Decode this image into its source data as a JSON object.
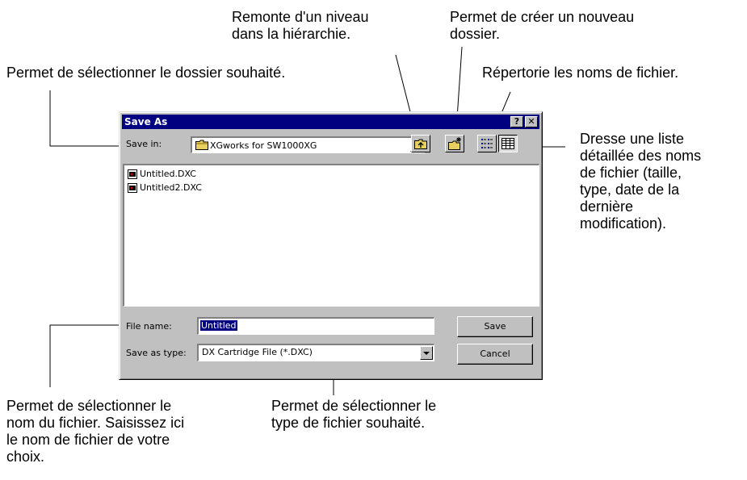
{
  "annotations": {
    "up_level": [
      "Remonte d'un niveau",
      "dans la hiérarchie."
    ],
    "new_folder": [
      "Permet de créer un nouveau",
      "dossier."
    ],
    "save_in": "Permet de sélectionner le dossier souhaité.",
    "list_view": "Répertorie les noms de fichier.",
    "details_view": [
      "Dresse une liste",
      "détaillée des noms",
      "de fichier (taille,",
      "type, date de la",
      "dernière",
      "modification)."
    ],
    "file_name": [
      "Permet de sélectionner le",
      "nom du fichier. Saisissez ici",
      "le nom de fichier de votre",
      "choix."
    ],
    "file_type": [
      "Permet de sélectionner le",
      "type de fichier souhaité."
    ]
  },
  "dialog": {
    "title": "Save As",
    "help_button": "?",
    "close_button": "✕",
    "save_in_label": "Save in:",
    "save_in_value": "XGworks for SW1000XG",
    "files": [
      "Untitled.DXC",
      "Untitled2.DXC"
    ],
    "file_name_label": "File name:",
    "file_name_value": "Untitled",
    "save_as_type_label": "Save as type:",
    "save_as_type_value": "DX Cartridge File (*.DXC)",
    "save_button": "Save",
    "cancel_button": "Cancel"
  },
  "icons": {
    "folder": "folder-icon",
    "up": "up-one-level-icon",
    "new_folder": "new-folder-icon",
    "list": "list-view-icon",
    "details": "details-view-icon",
    "file": "dxc-file-icon"
  },
  "colors": {
    "title_bar": "#000080",
    "dialog_face": "#c0c0c0",
    "selection": "#000080"
  }
}
